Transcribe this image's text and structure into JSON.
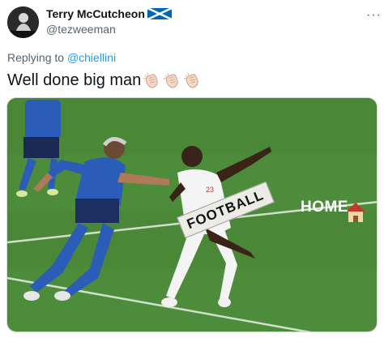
{
  "author": {
    "display_name": "Terry McCutcheon",
    "handle": "@tezweeman",
    "flag_icon": "scotland-flag-icon"
  },
  "menu": {
    "more_label": "···"
  },
  "reply": {
    "prefix": "Replying to",
    "mention": "@chiellini"
  },
  "tweet": {
    "text": "Well done big man",
    "emoji": [
      "clapping-hands-icon",
      "clapping-hands-icon",
      "clapping-hands-icon"
    ]
  },
  "media": {
    "sticker_football": "FOOTBALL",
    "sticker_home": "HOME",
    "home_icon": "house-icon"
  },
  "colors": {
    "pitch": "#4f8f3d",
    "link": "#1d9bf0",
    "muted": "#536471",
    "italy_kit": "#2a5cb8",
    "england_kit": "#f4f4f4"
  }
}
